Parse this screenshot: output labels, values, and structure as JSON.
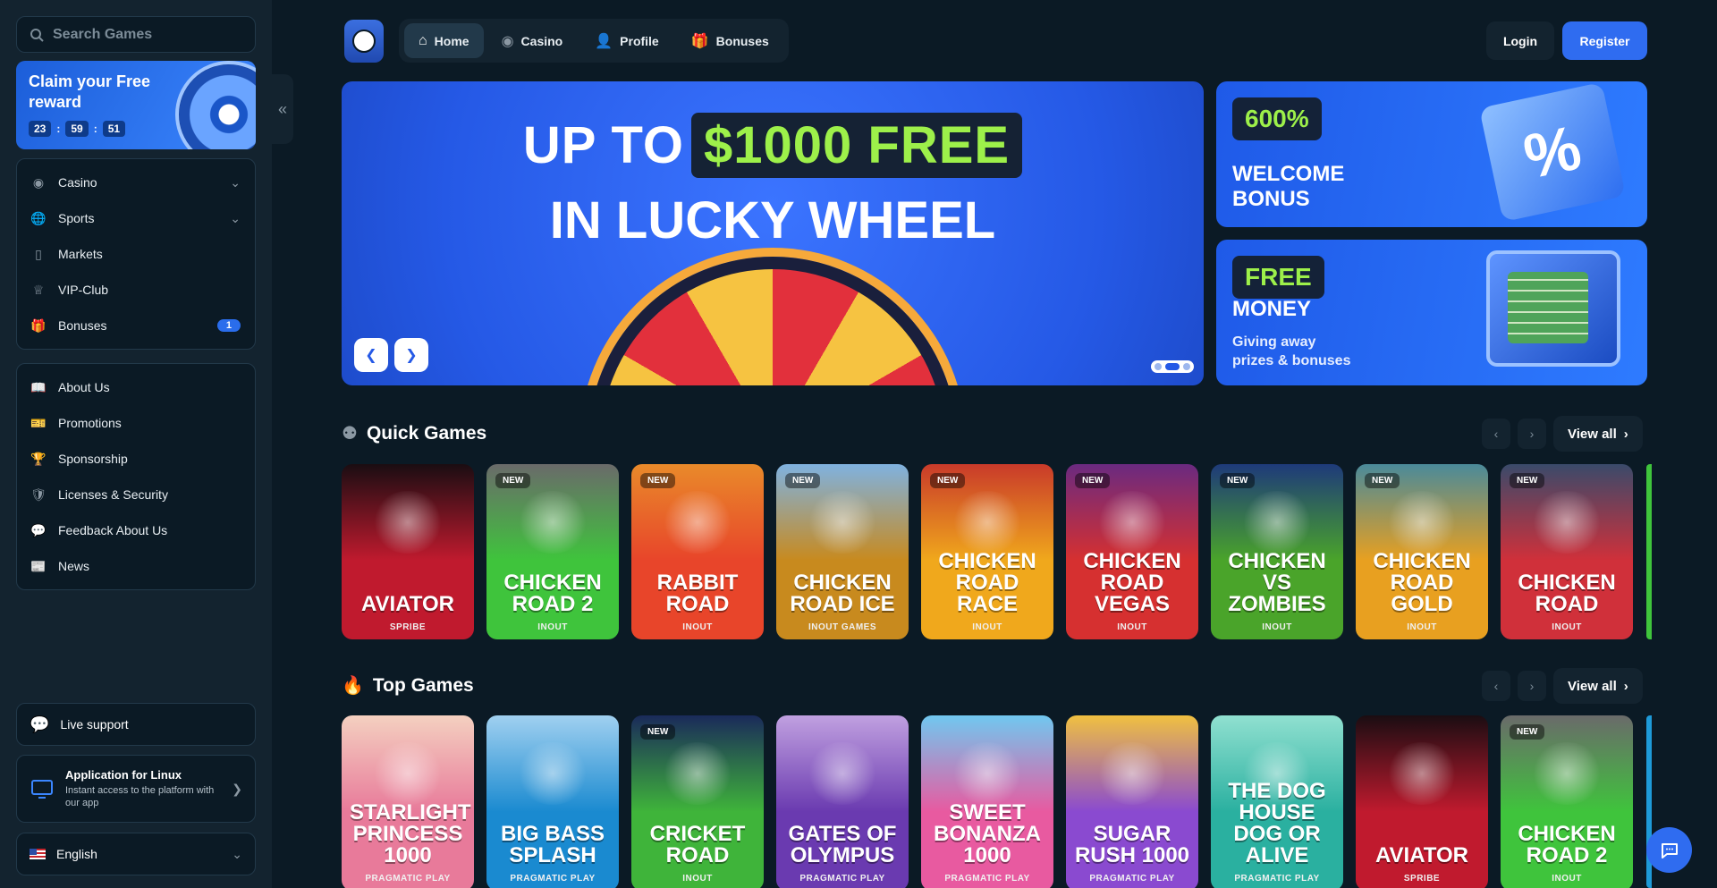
{
  "sidebar": {
    "search_placeholder": "Search Games",
    "claim": {
      "title": "Claim your Free reward",
      "timer": [
        "23",
        "59",
        "51"
      ]
    },
    "menu1": [
      {
        "label": "Casino",
        "icon": "casino-chip-icon",
        "chevron": true
      },
      {
        "label": "Sports",
        "icon": "globe-icon",
        "chevron": true
      },
      {
        "label": "Markets",
        "icon": "candlestick-icon"
      },
      {
        "label": "VIP-Club",
        "icon": "crown-icon"
      },
      {
        "label": "Bonuses",
        "icon": "gift-icon",
        "badge": "1"
      }
    ],
    "menu2": [
      {
        "label": "About Us",
        "icon": "book-icon"
      },
      {
        "label": "Promotions",
        "icon": "ticket-icon"
      },
      {
        "label": "Sponsorship",
        "icon": "trophy-icon"
      },
      {
        "label": "Licenses & Security",
        "icon": "shield-icon"
      },
      {
        "label": "Feedback About Us",
        "icon": "feedback-icon"
      },
      {
        "label": "News",
        "icon": "newspaper-icon"
      }
    ],
    "live_support": "Live support",
    "app": {
      "title": "Application for Linux",
      "subtitle": "Instant access to the platform with our app"
    },
    "language": "English"
  },
  "topnav": {
    "tabs": [
      {
        "label": "Home",
        "icon": "home-icon",
        "active": true
      },
      {
        "label": "Casino",
        "icon": "casino-chip-icon"
      },
      {
        "label": "Profile",
        "icon": "user-icon"
      },
      {
        "label": "Bonuses",
        "icon": "gift-icon"
      }
    ],
    "login": "Login",
    "register": "Register"
  },
  "hero": {
    "line1": "UP TO",
    "highlight": "$1000 FREE",
    "line2": "IN LUCKY WHEEL"
  },
  "promos": {
    "welcome": {
      "pill": "600%",
      "title1": "WELCOME",
      "title2": "BONUS"
    },
    "money": {
      "pill": "FREE",
      "title": "MONEY",
      "sub1": "Giving away",
      "sub2": "prizes & bonuses"
    }
  },
  "quick_games": {
    "title": "Quick Games",
    "view_all": "View all",
    "games": [
      {
        "name": "AVIATOR",
        "provider": "SPRIBE",
        "new": false,
        "color": "#c01a2e",
        "color2": "#1a0d12"
      },
      {
        "name": "CHICKEN ROAD 2",
        "provider": "INOUT",
        "new": true,
        "color": "#3fc43c",
        "color2": "#6a6a6a"
      },
      {
        "name": "RABBIT ROAD",
        "provider": "INOUT",
        "new": true,
        "color": "#e8452a",
        "color2": "#e98a2a"
      },
      {
        "name": "CHICKEN ROAD ICE",
        "provider": "INOUT GAMES",
        "new": true,
        "color": "#c88a1e",
        "color2": "#7fb2e0"
      },
      {
        "name": "CHICKEN ROAD RACE",
        "provider": "INOUT",
        "new": true,
        "color": "#f0a81c",
        "color2": "#c93a2a"
      },
      {
        "name": "CHICKEN ROAD VEGAS",
        "provider": "INOUT",
        "new": true,
        "color": "#d63030",
        "color2": "#6a2a80"
      },
      {
        "name": "CHICKEN VS ZOMBIES",
        "provider": "INOUT",
        "new": true,
        "color": "#4aa42a",
        "color2": "#1e3a7a"
      },
      {
        "name": "CHICKEN ROAD GOLD",
        "provider": "INOUT",
        "new": true,
        "color": "#e8a020",
        "color2": "#4a8a9a"
      },
      {
        "name": "CHICKEN ROAD",
        "provider": "INOUT",
        "new": true,
        "color": "#d0303a",
        "color2": "#3a4a6a"
      }
    ]
  },
  "top_games": {
    "title": "Top Games",
    "view_all": "View all",
    "games": [
      {
        "name": "STARLIGHT PRINCESS 1000",
        "provider": "PRAGMATIC PLAY",
        "new": false,
        "color": "#e87a9a",
        "color2": "#f4d0c0"
      },
      {
        "name": "BIG BASS SPLASH",
        "provider": "PRAGMATIC PLAY",
        "new": false,
        "color": "#1a8ad0",
        "color2": "#a0d0f0"
      },
      {
        "name": "CRICKET ROAD",
        "provider": "INOUT",
        "new": true,
        "color": "#3fb43a",
        "color2": "#1a2a5a"
      },
      {
        "name": "GATES OF OLYMPUS",
        "provider": "PRAGMATIC PLAY",
        "new": false,
        "color": "#6a3ab0",
        "color2": "#c0a0e0"
      },
      {
        "name": "SWEET BONANZA 1000",
        "provider": "PRAGMATIC PLAY",
        "new": false,
        "color": "#e85aa0",
        "color2": "#70c8f0"
      },
      {
        "name": "SUGAR RUSH 1000",
        "provider": "PRAGMATIC PLAY",
        "new": false,
        "color": "#8a4ad0",
        "color2": "#f0c040"
      },
      {
        "name": "THE DOG HOUSE DOG OR ALIVE",
        "provider": "PRAGMATIC PLAY",
        "new": false,
        "color": "#2ab0a0",
        "color2": "#90e0d0"
      },
      {
        "name": "AVIATOR",
        "provider": "SPRIBE",
        "new": false,
        "color": "#c01a2e",
        "color2": "#1a0d12"
      },
      {
        "name": "CHICKEN ROAD 2",
        "provider": "INOUT",
        "new": true,
        "color": "#3fc43c",
        "color2": "#6a6a6a"
      }
    ]
  }
}
